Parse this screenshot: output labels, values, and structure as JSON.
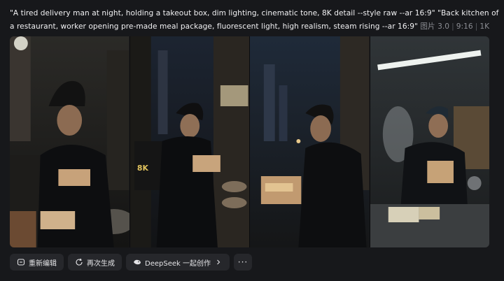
{
  "prompt": {
    "text": "\"A tired delivery man at night, holding a takeout box, dim lighting, cinematic tone, 8K detail --style raw --ar 16:9\" \"Back kitchen of a restaurant, worker opening pre-made meal package, fluorescent light, high realism, steam rising --ar 16:9\"",
    "model": "图片 3.0",
    "ratio": "9:16",
    "resolution": "1K"
  },
  "images": [
    {
      "alt": "Tired delivery man in helmet holding open takeout box on night street"
    },
    {
      "alt": "Delivery man with 8K backpack holding takeout box at night"
    },
    {
      "alt": "Man in black shirt opening takeout box on city street"
    },
    {
      "alt": "Kitchen worker in cap opening meal package under fluorescent light"
    }
  ],
  "actions": {
    "edit_label": "重新编辑",
    "regenerate_label": "再次生成",
    "deepseek_label": "DeepSeek 一起创作",
    "more_label": "···"
  },
  "colors": {
    "background": "#17181b",
    "button_bg": "#26272b",
    "meta_text": "#8b8d93"
  }
}
